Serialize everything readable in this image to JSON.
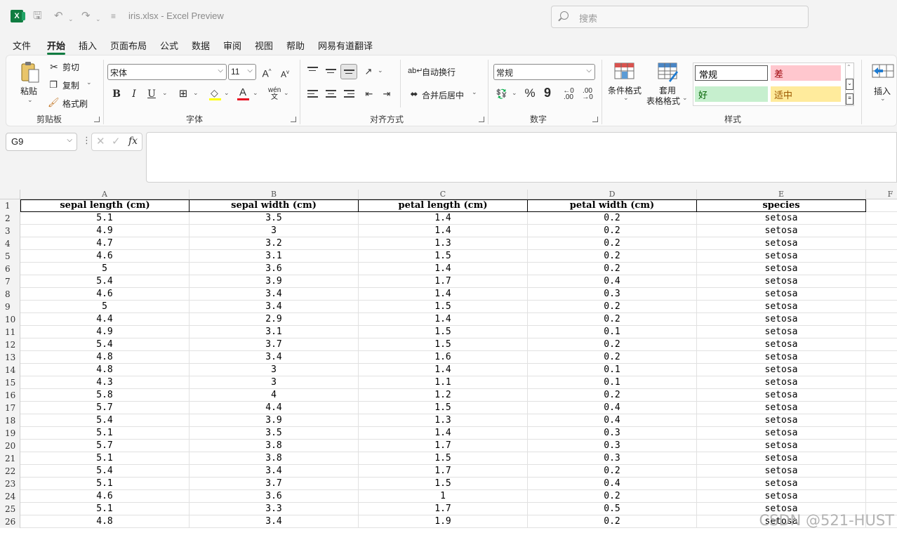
{
  "title_bar": {
    "doc_title": "iris.xlsx  -  Excel Preview",
    "search_placeholder": "搜索"
  },
  "menu": {
    "tabs": [
      "文件",
      "开始",
      "插入",
      "页面布局",
      "公式",
      "数据",
      "审阅",
      "视图",
      "帮助",
      "网易有道翻译"
    ],
    "active_tab": "开始"
  },
  "ribbon": {
    "clipboard": {
      "paste": "粘贴",
      "cut": "剪切",
      "copy": "复制",
      "format_painter": "格式刷",
      "group_label": "剪贴板"
    },
    "font": {
      "font_name": "宋体",
      "font_size": "11",
      "bold": "B",
      "italic": "I",
      "underline": "U",
      "group_label": "字体"
    },
    "alignment": {
      "wrap_text": "自动换行",
      "merge_center": "合并后居中",
      "group_label": "对齐方式"
    },
    "number": {
      "format": "常规",
      "percent": "%",
      "comma": "9",
      "group_label": "数字"
    },
    "styles": {
      "conditional_format": "条件格式",
      "table_format_line1": "套用",
      "table_format_line2": "表格格式",
      "normal": "常规",
      "bad": "差",
      "good": "好",
      "neutral": "适中",
      "group_label": "样式"
    },
    "cells": {
      "insert": "插入"
    }
  },
  "formula_bar": {
    "name_box": "G9",
    "fx": "fx",
    "formula": ""
  },
  "sheet": {
    "col_letters": [
      "A",
      "B",
      "C",
      "D",
      "E",
      "F"
    ],
    "headers": [
      "sepal length (cm)",
      "sepal width (cm)",
      "petal length (cm)",
      "petal width (cm)",
      "species"
    ],
    "row_numbers": [
      "1",
      "2",
      "3",
      "4",
      "5",
      "6",
      "7",
      "8",
      "9",
      "10",
      "11",
      "12",
      "13",
      "14",
      "15",
      "16",
      "17",
      "18",
      "19",
      "20",
      "21",
      "22",
      "23",
      "24",
      "25",
      "26"
    ],
    "rows": [
      [
        "5.1",
        "3.5",
        "1.4",
        "0.2",
        "setosa"
      ],
      [
        "4.9",
        "3",
        "1.4",
        "0.2",
        "setosa"
      ],
      [
        "4.7",
        "3.2",
        "1.3",
        "0.2",
        "setosa"
      ],
      [
        "4.6",
        "3.1",
        "1.5",
        "0.2",
        "setosa"
      ],
      [
        "5",
        "3.6",
        "1.4",
        "0.2",
        "setosa"
      ],
      [
        "5.4",
        "3.9",
        "1.7",
        "0.4",
        "setosa"
      ],
      [
        "4.6",
        "3.4",
        "1.4",
        "0.3",
        "setosa"
      ],
      [
        "5",
        "3.4",
        "1.5",
        "0.2",
        "setosa"
      ],
      [
        "4.4",
        "2.9",
        "1.4",
        "0.2",
        "setosa"
      ],
      [
        "4.9",
        "3.1",
        "1.5",
        "0.1",
        "setosa"
      ],
      [
        "5.4",
        "3.7",
        "1.5",
        "0.2",
        "setosa"
      ],
      [
        "4.8",
        "3.4",
        "1.6",
        "0.2",
        "setosa"
      ],
      [
        "4.8",
        "3",
        "1.4",
        "0.1",
        "setosa"
      ],
      [
        "4.3",
        "3",
        "1.1",
        "0.1",
        "setosa"
      ],
      [
        "5.8",
        "4",
        "1.2",
        "0.2",
        "setosa"
      ],
      [
        "5.7",
        "4.4",
        "1.5",
        "0.4",
        "setosa"
      ],
      [
        "5.4",
        "3.9",
        "1.3",
        "0.4",
        "setosa"
      ],
      [
        "5.1",
        "3.5",
        "1.4",
        "0.3",
        "setosa"
      ],
      [
        "5.7",
        "3.8",
        "1.7",
        "0.3",
        "setosa"
      ],
      [
        "5.1",
        "3.8",
        "1.5",
        "0.3",
        "setosa"
      ],
      [
        "5.4",
        "3.4",
        "1.7",
        "0.2",
        "setosa"
      ],
      [
        "5.1",
        "3.7",
        "1.5",
        "0.4",
        "setosa"
      ],
      [
        "4.6",
        "3.6",
        "1",
        "0.2",
        "setosa"
      ],
      [
        "5.1",
        "3.3",
        "1.7",
        "0.5",
        "setosa"
      ],
      [
        "4.8",
        "3.4",
        "1.9",
        "0.2",
        "setosa"
      ]
    ]
  },
  "watermark": "CSDN @521-HUST"
}
